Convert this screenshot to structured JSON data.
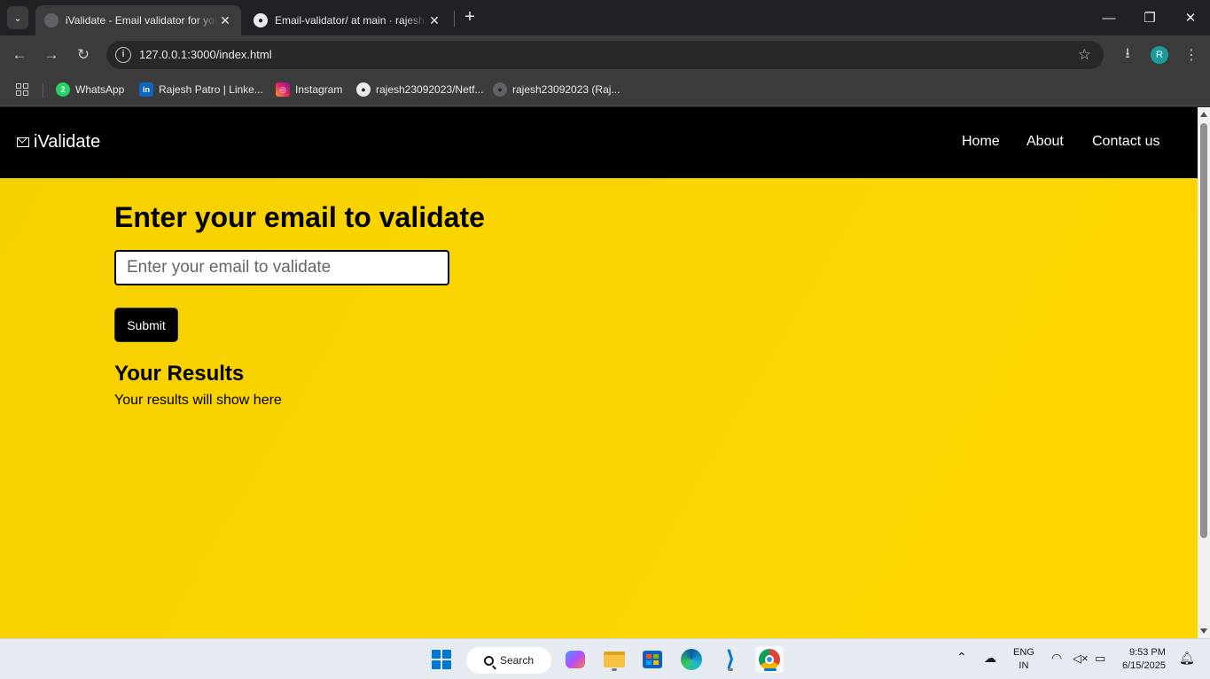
{
  "browser": {
    "tabs": [
      {
        "title": "iValidate - Email validator for you",
        "active": true
      },
      {
        "title": "Email-validator/ at main · rajesh23092023",
        "active": false
      }
    ],
    "address": "127.0.0.1:3000/index.html",
    "profile_initial": "R",
    "bookmarks": [
      {
        "label": "WhatsApp",
        "badge": "2"
      },
      {
        "label": "Rajesh Patro | Linke...",
        "badge": "in"
      },
      {
        "label": "Instagram"
      },
      {
        "label": "rajesh23092023/Netf..."
      },
      {
        "label": "rajesh23092023 (Raj..."
      }
    ]
  },
  "site": {
    "brand": "iValidate",
    "nav": [
      "Home",
      "About",
      "Contact us"
    ],
    "heading": "Enter your email to validate",
    "email_placeholder": "Enter your email to validate",
    "email_value": "",
    "submit_label": "Submit",
    "results_heading": "Your Results",
    "results_text": "Your results will show here"
  },
  "taskbar": {
    "search_label": "Search",
    "language": "ENG",
    "region": "IN",
    "time": "9:53 PM",
    "date": "6/15/2025"
  },
  "colors": {
    "page_background": "#fad500",
    "nav_background": "#000000",
    "accent_profile": "#1a9c9c"
  }
}
